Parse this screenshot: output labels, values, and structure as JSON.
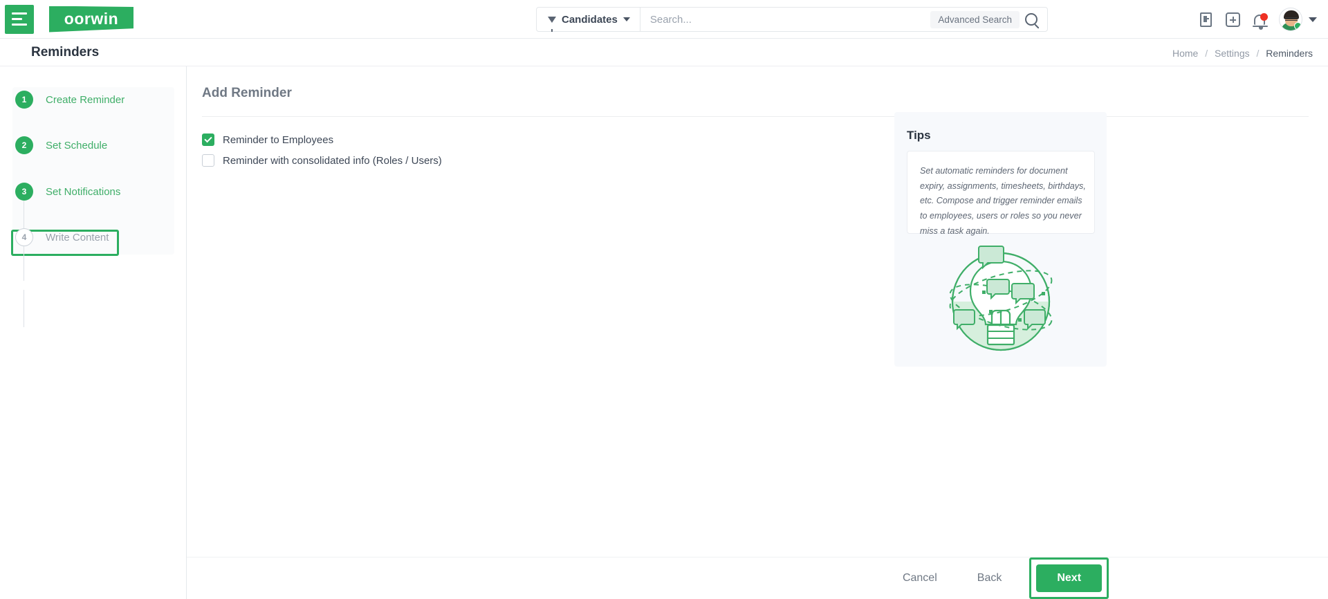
{
  "brand": {
    "logo_text": "oorwin",
    "green": "#2cae60",
    "red": "#ee3124"
  },
  "topbar": {
    "menu_icon": "hamburger-icon",
    "entity_filter": {
      "label": "Candidates",
      "filter_icon": "funnel-icon",
      "caret_icon": "chevron-down-icon"
    },
    "search": {
      "value": "",
      "placeholder": "Search...",
      "advanced_label": "Advanced Search",
      "search_icon": "search-icon"
    },
    "icons": [
      {
        "name": "form-list-icon"
      },
      {
        "name": "add-plus-icon"
      },
      {
        "name": "notifications-bell-icon",
        "badge": true
      }
    ],
    "profile": {
      "avatar_icon": "user-avatar",
      "status": "online",
      "caret_icon": "chevron-down-icon"
    }
  },
  "pagehead": {
    "title": "Reminders",
    "breadcrumb": {
      "items": [
        "Home",
        "Settings",
        "Reminders"
      ],
      "separator": "/"
    }
  },
  "sidebar": {
    "steps": [
      {
        "number": "1",
        "label": "Create Reminder",
        "state": "done"
      },
      {
        "number": "2",
        "label": "Set Schedule",
        "state": "done"
      },
      {
        "number": "3",
        "label": "Set Notifications",
        "state": "active"
      },
      {
        "number": "4",
        "label": "Write Content",
        "state": "todo"
      }
    ]
  },
  "main": {
    "title": "Add Reminder",
    "options": [
      {
        "label": "Reminder to Employees",
        "checked": true
      },
      {
        "label": "Reminder with consolidated info (Roles / Users)",
        "checked": false
      }
    ]
  },
  "tips": {
    "title": "Tips",
    "body": "Set automatic reminders for document expiry, assignments, timesheets, birthdays, etc. Compose and trigger reminder emails to employees, users or roles so you never miss a task again.",
    "illustration": "lightbulb-orbit-illustration"
  },
  "footer": {
    "cancel_label": "Cancel",
    "back_label": "Back",
    "next_label": "Next"
  }
}
